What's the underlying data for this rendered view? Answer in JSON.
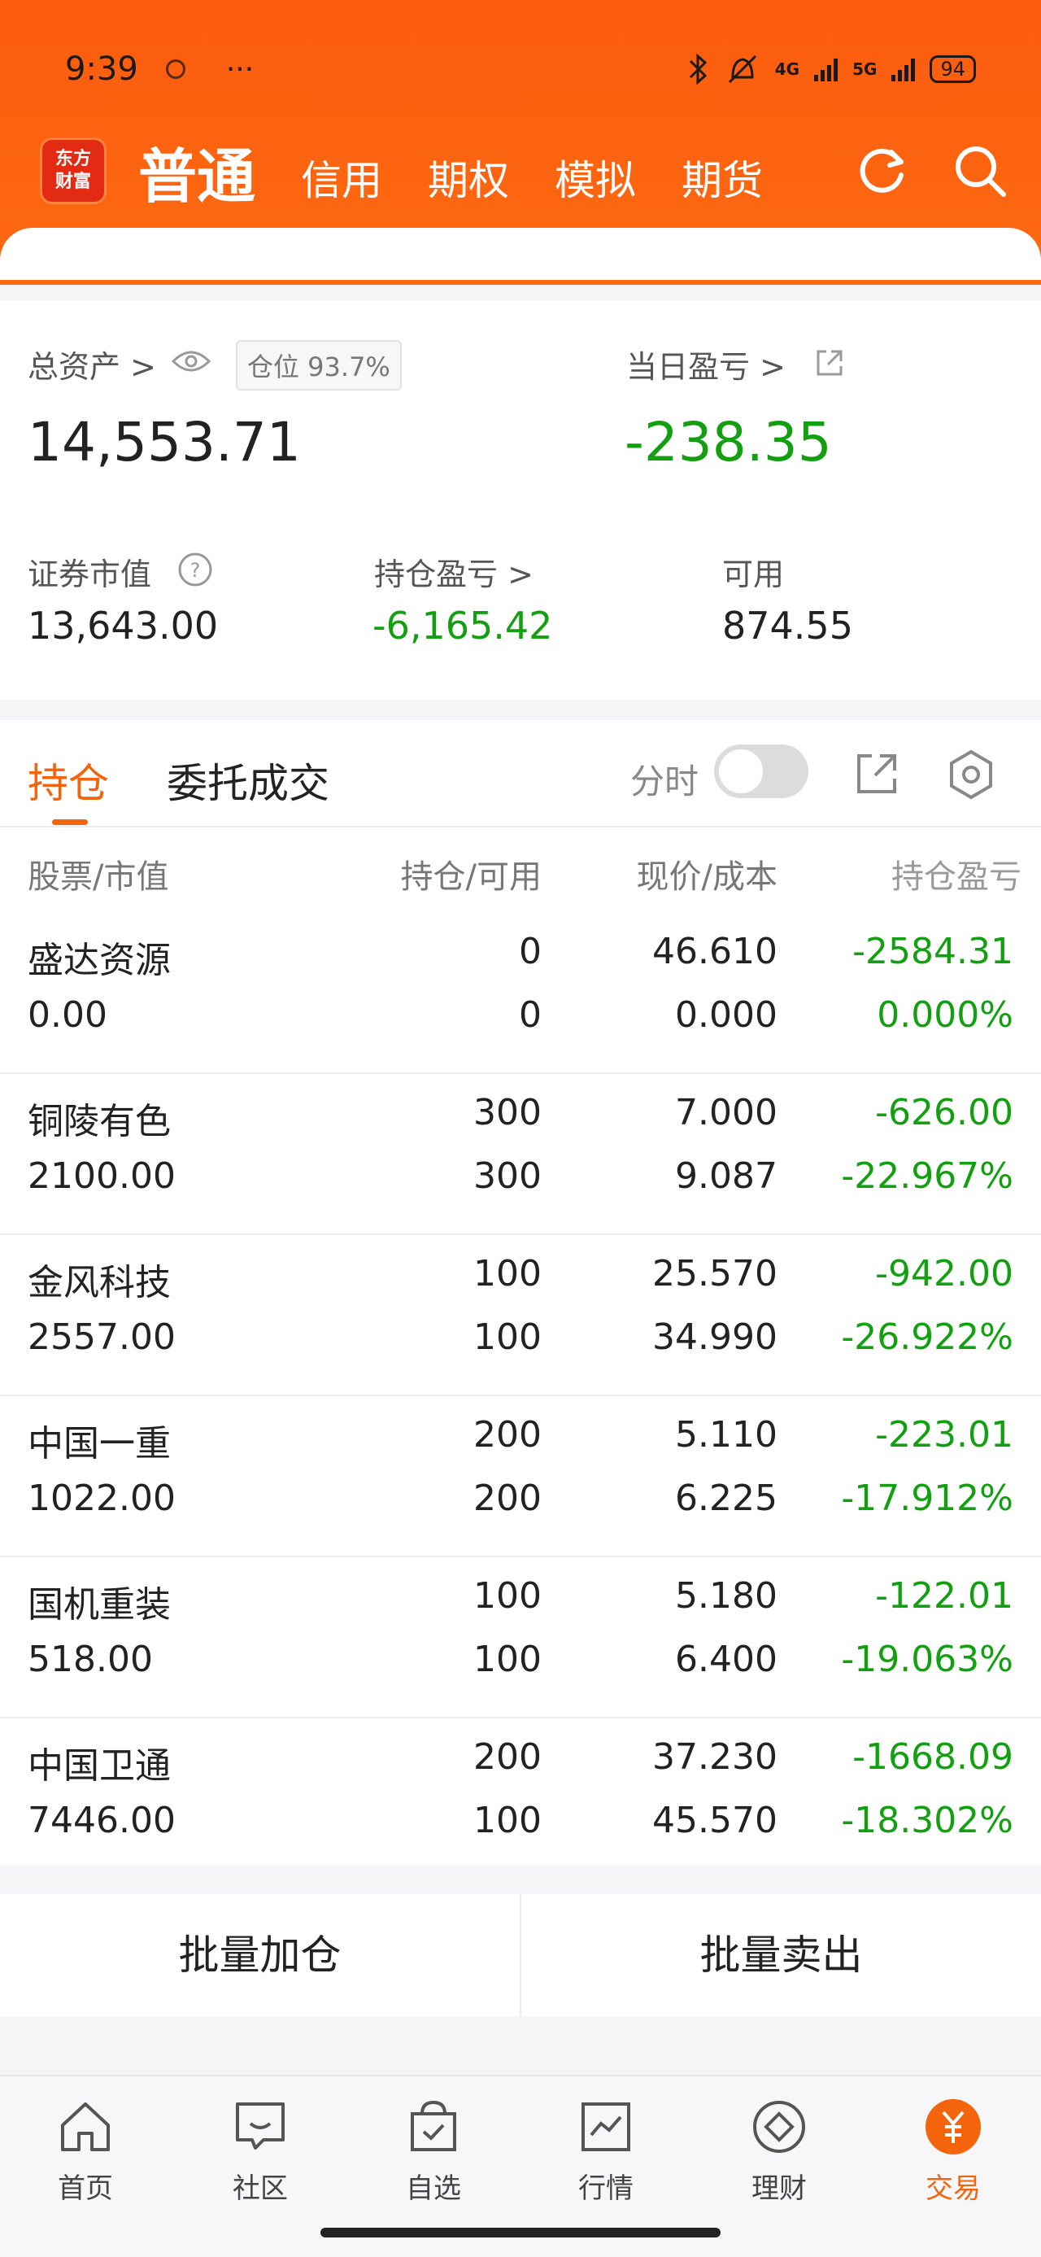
{
  "status": {
    "time": "9:39",
    "dots": "···",
    "net1": "4G",
    "net2": "5G",
    "battery": "94"
  },
  "nav": {
    "logo": "东方财富",
    "main": "普通",
    "tabs": [
      "信用",
      "期权",
      "模拟",
      "期货"
    ]
  },
  "summary": {
    "total_assets_label": "总资产 >",
    "position_tag": "仓位  93.7%",
    "total_assets": "14,553.71",
    "daily_pl_label": "当日盈亏 >",
    "daily_pl": "-238.35",
    "market_value_label": "证券市值",
    "market_value": "13,643.00",
    "holding_pl_label": "持仓盈亏 >",
    "holding_pl": "-6,165.42",
    "available_label": "可用",
    "available": "874.55"
  },
  "holdings_tabs": {
    "active": "持仓",
    "other": "委托成交",
    "fenshi": "分时"
  },
  "table": {
    "headers": [
      "股票/市值",
      "持仓/可用",
      "现价/成本",
      "持仓盈亏"
    ],
    "rows": [
      {
        "name": "盛达资源",
        "value": "0.00",
        "pos": "0",
        "avail": "0",
        "price": "46.610",
        "cost": "0.000",
        "pl": "-2584.31",
        "pct": "0.000%"
      },
      {
        "name": "铜陵有色",
        "value": "2100.00",
        "pos": "300",
        "avail": "300",
        "price": "7.000",
        "cost": "9.087",
        "pl": "-626.00",
        "pct": "-22.967%"
      },
      {
        "name": "金风科技",
        "value": "2557.00",
        "pos": "100",
        "avail": "100",
        "price": "25.570",
        "cost": "34.990",
        "pl": "-942.00",
        "pct": "-26.922%"
      },
      {
        "name": "中国一重",
        "value": "1022.00",
        "pos": "200",
        "avail": "200",
        "price": "5.110",
        "cost": "6.225",
        "pl": "-223.01",
        "pct": "-17.912%"
      },
      {
        "name": "国机重装",
        "value": "518.00",
        "pos": "100",
        "avail": "100",
        "price": "5.180",
        "cost": "6.400",
        "pl": "-122.01",
        "pct": "-19.063%"
      },
      {
        "name": "中国卫通",
        "value": "7446.00",
        "pos": "200",
        "avail": "100",
        "price": "37.230",
        "cost": "45.570",
        "pl": "-1668.09",
        "pct": "-18.302%"
      }
    ]
  },
  "batch": {
    "add": "批量加仓",
    "sell": "批量卖出"
  },
  "tabbar": [
    "首页",
    "社区",
    "自选",
    "行情",
    "理财",
    "交易"
  ],
  "colors": {
    "accent": "#f3640c",
    "loss": "#12a010"
  }
}
